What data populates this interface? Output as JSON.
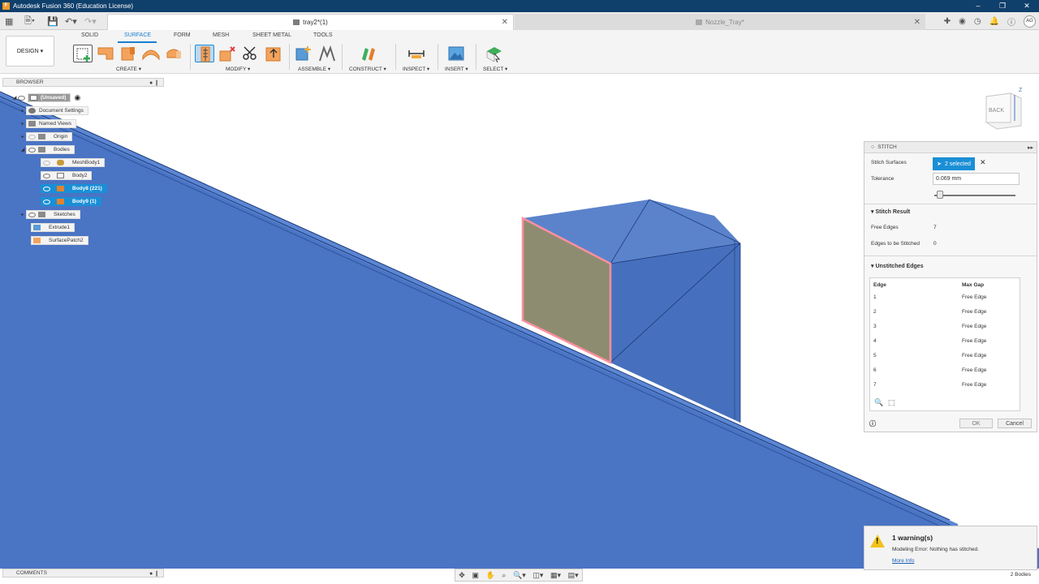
{
  "window": {
    "title": "Autodesk Fusion 360 (Education License)"
  },
  "tabs": [
    {
      "label": "tray2*(1)",
      "active": true
    },
    {
      "label": "Nozzle_Tray*",
      "active": false
    }
  ],
  "user": {
    "initials": "AG"
  },
  "toolbar": {
    "workspace_button": "DESIGN ▾",
    "tabs": [
      "SOLID",
      "SURFACE",
      "FORM",
      "MESH",
      "SHEET METAL",
      "TOOLS"
    ],
    "active_tab": "SURFACE",
    "groups": [
      "CREATE ▾",
      "MODIFY ▾",
      "ASSEMBLE ▾",
      "CONSTRUCT ▾",
      "INSPECT ▾",
      "INSERT ▾",
      "SELECT ▾"
    ]
  },
  "browser": {
    "title": "BROWSER",
    "root": "(Unsaved)",
    "items": {
      "document_settings": "Document Settings",
      "named_views": "Named Views",
      "origin": "Origin",
      "bodies": "Bodies",
      "meshbody1": "MeshBody1",
      "body2": "Body2",
      "body8": "Body8 (221)",
      "body9": "Body9 (1)",
      "sketches": "Sketches",
      "extrude1": "Extrude1",
      "surfacepatch2": "SurfacePatch2"
    }
  },
  "viewcube": {
    "face": "BACK",
    "axis": "Z"
  },
  "stitch": {
    "title": "STITCH",
    "surfaces_label": "Stitch Surfaces",
    "surfaces_value": "2 selected",
    "tolerance_label": "Tolerance",
    "tolerance_value": "0.069 mm",
    "tolerance_slider": 0.05,
    "result_title": "Stitch Result",
    "free_edges_label": "Free Edges",
    "free_edges_value": "7",
    "to_stitch_label": "Edges to be Stitched",
    "to_stitch_value": "0",
    "unstitched_title": "Unstitched Edges",
    "col_edge": "Edge",
    "col_gap": "Max Gap",
    "edges": [
      {
        "edge": "1",
        "gap": "Free Edge"
      },
      {
        "edge": "2",
        "gap": "Free Edge"
      },
      {
        "edge": "3",
        "gap": "Free Edge"
      },
      {
        "edge": "4",
        "gap": "Free Edge"
      },
      {
        "edge": "5",
        "gap": "Free Edge"
      },
      {
        "edge": "6",
        "gap": "Free Edge"
      },
      {
        "edge": "7",
        "gap": "Free Edge"
      }
    ],
    "ok": "OK",
    "cancel": "Cancel"
  },
  "comments": {
    "title": "COMMENTS"
  },
  "warning": {
    "title": "1 warning(s)",
    "message": "Modeling Error: Nothing has stitched.",
    "link": "More Info"
  },
  "status": {
    "bodies": "2 Bodies"
  },
  "colors": {
    "accent": "#1a8fd6",
    "model_blue": "#4a74c4",
    "face_olive": "#8e8c70",
    "title_bar": "#0f3f6b"
  }
}
